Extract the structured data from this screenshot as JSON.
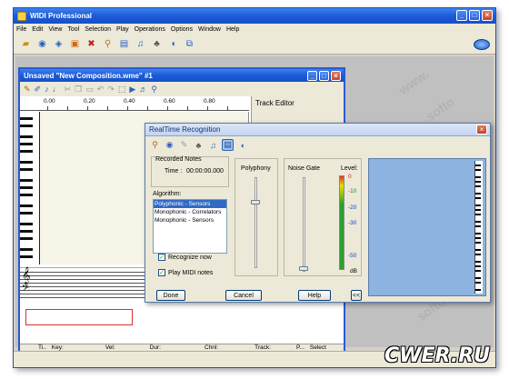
{
  "app": {
    "title": "WIDI Professional",
    "menu": [
      "File",
      "Edit",
      "View",
      "Tool",
      "Selection",
      "Play",
      "Operations",
      "Options",
      "Window",
      "Help"
    ]
  },
  "composition": {
    "title": "Unsaved \"New Composition.wme\" #1",
    "ruler": [
      "0.00",
      "0.20",
      "0.40",
      "0.60",
      "0.80"
    ],
    "track_editor_label": "Track Editor",
    "columns": [
      "Ti..",
      "Key:",
      "Vel:",
      "Dur:",
      "Chnl:",
      "Track:",
      "P...",
      "Select"
    ]
  },
  "dialog": {
    "title": "RealTime Recognition",
    "recorded_notes_label": "Recorded Notes",
    "time_label": "Time :",
    "time_value": "00:00:00.000",
    "algorithm_label": "Algorithm:",
    "algorithms": [
      "Polyphonic - Sensors",
      "Monophonic - Correlators",
      "Monophonic - Sensors"
    ],
    "selected_algorithm": 0,
    "recognize_now": "Recognize now",
    "play_midi": "Play MIDI notes",
    "polyphony_label": "Polyphony",
    "noise_gate_label": "Noise Gate",
    "level_label": "Level:",
    "level_ticks": [
      "0",
      "-10",
      "-20",
      "-30",
      "-50"
    ],
    "db_label": "dB",
    "buttons": {
      "done": "Done",
      "cancel": "Cancel",
      "help": "Help",
      "collapse": "<<"
    }
  },
  "watermark": "CWER.RU"
}
